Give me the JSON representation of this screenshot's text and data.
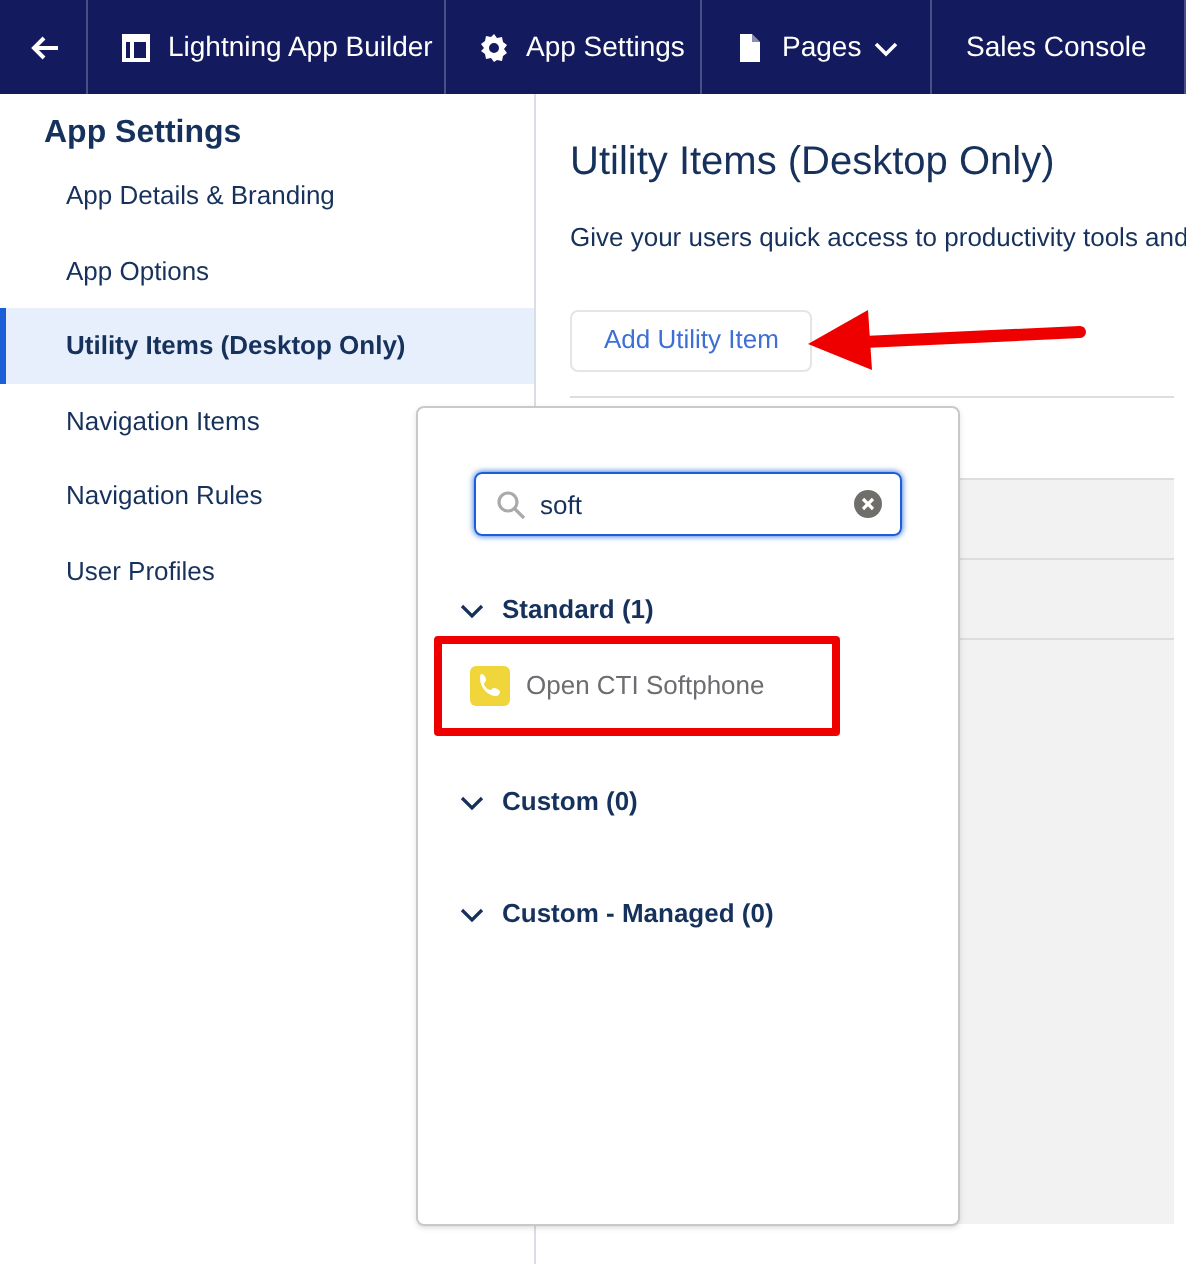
{
  "top_bar": {
    "items": [
      {
        "kind": "back"
      },
      {
        "kind": "builder",
        "label": "Lightning App Builder"
      },
      {
        "kind": "settings",
        "label": "App Settings"
      },
      {
        "kind": "pages",
        "label": "Pages"
      },
      {
        "kind": "plain",
        "label": "Sales Console"
      }
    ]
  },
  "sidebar": {
    "title": "App Settings",
    "items": [
      {
        "label": "App Details & Branding",
        "selected": false
      },
      {
        "label": "App Options",
        "selected": false
      },
      {
        "label": "Utility Items (Desktop Only)",
        "selected": true
      },
      {
        "label": "Navigation Items",
        "selected": false
      },
      {
        "label": "Navigation Rules",
        "selected": false
      },
      {
        "label": "User Profiles",
        "selected": false
      }
    ]
  },
  "main": {
    "title": "Utility Items (Desktop Only)",
    "description": "Give your users quick access to productivity tools and",
    "add_button": "Add Utility Item"
  },
  "popover": {
    "search": {
      "value": "soft"
    },
    "groups": [
      {
        "label": "Standard (1)",
        "expanded": true,
        "items": [
          {
            "label": "Open CTI Softphone"
          }
        ]
      },
      {
        "label": "Custom (0)",
        "expanded": true
      },
      {
        "label": "Custom - Managed (0)",
        "expanded": true
      }
    ]
  }
}
